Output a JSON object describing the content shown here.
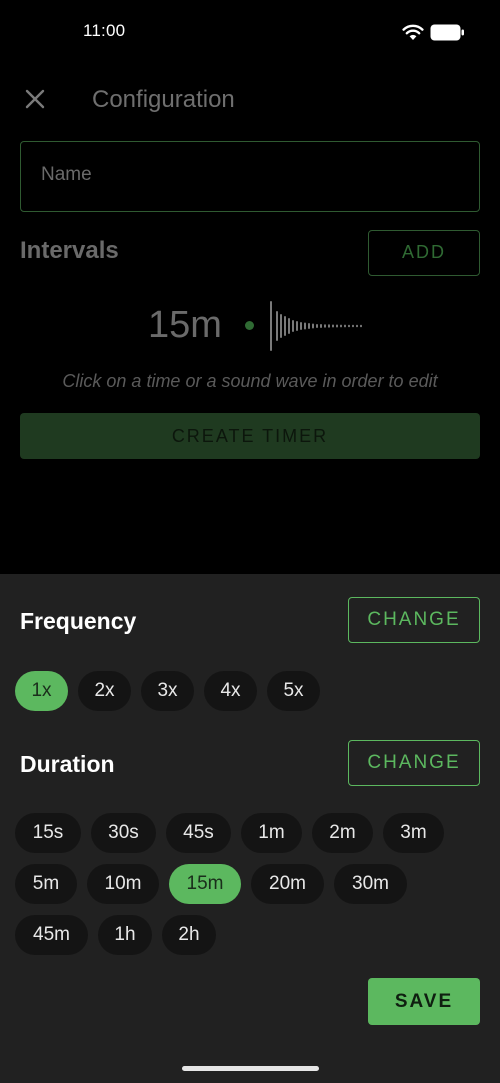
{
  "status_bar": {
    "time": "11:00"
  },
  "header": {
    "title": "Configuration"
  },
  "name_field": {
    "placeholder": "Name"
  },
  "intervals": {
    "title": "Intervals",
    "add_label": "ADD",
    "items": [
      {
        "time": "15m"
      }
    ]
  },
  "hint": "Click on a time or a sound wave in order to edit",
  "create_label": "CREATE TIMER",
  "sheet": {
    "frequency": {
      "title": "Frequency",
      "change_label": "CHANGE",
      "options": [
        "1x",
        "2x",
        "3x",
        "4x",
        "5x"
      ],
      "selected": "1x"
    },
    "duration": {
      "title": "Duration",
      "change_label": "CHANGE",
      "options": [
        "15s",
        "30s",
        "45s",
        "1m",
        "2m",
        "3m",
        "5m",
        "10m",
        "15m",
        "20m",
        "30m",
        "45m",
        "1h",
        "2h"
      ],
      "selected": "15m"
    },
    "save_label": "SAVE"
  },
  "colors": {
    "accent": "#5cb85f",
    "sheet_background": "#212121",
    "chip_background": "#141414"
  }
}
